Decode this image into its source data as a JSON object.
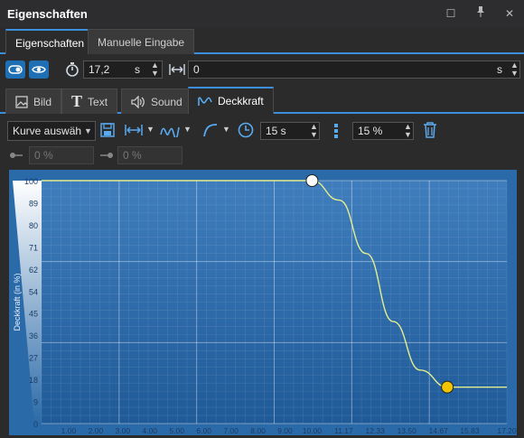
{
  "window": {
    "title": "Eigenschaften"
  },
  "tabs_top": [
    {
      "label": "Eigenschaften",
      "active": true
    },
    {
      "label": "Manuelle Eingabe",
      "active": false
    }
  ],
  "toolbar": {
    "duration_value": "17,2",
    "duration_unit": "s",
    "offset_value": "0",
    "offset_unit": "s"
  },
  "tabs_sub": [
    {
      "label": "Bild",
      "icon": "image-icon"
    },
    {
      "label": "Text",
      "icon": "text-icon"
    },
    {
      "label": "Sound",
      "icon": "speaker-icon"
    },
    {
      "label": "Deckkraft",
      "icon": "opacity-wave-icon",
      "active": true
    }
  ],
  "curve_toolbar": {
    "curve_select": "Kurve auswäh",
    "time_value": "15 s",
    "percent_value": "15 %"
  },
  "disabled_row": {
    "left_value": "0 %",
    "right_value": "0 %"
  },
  "chart_data": {
    "type": "line",
    "ylabel": "Deckkraft (in %)",
    "y_ticks": [
      "100",
      "89",
      "80",
      "71",
      "62",
      "54",
      "45",
      "36",
      "27",
      "18",
      "9",
      "0"
    ],
    "x_ticks": [
      "1.00",
      "2.00",
      "3.00",
      "4.00",
      "5.00",
      "6.00",
      "7.00",
      "8.00",
      "9.00",
      "10.00",
      "11.17",
      "12.33",
      "13.50",
      "14.67",
      "15.83",
      "17.20"
    ],
    "ylim": [
      0,
      100
    ],
    "xlim": [
      0,
      17.2
    ],
    "series": [
      {
        "x": [
          0,
          10.0,
          11.0,
          12.0,
          13.0,
          14.0,
          15.0,
          17.2
        ],
        "y": [
          100,
          100,
          92,
          70,
          42,
          22,
          15,
          15
        ]
      }
    ],
    "keyframes": [
      {
        "x": 10.0,
        "y": 100,
        "color": "#ffffff"
      },
      {
        "x": 15.0,
        "y": 15,
        "color": "#f2c400"
      }
    ],
    "line_color": "#e3ef8c",
    "grid": true
  }
}
